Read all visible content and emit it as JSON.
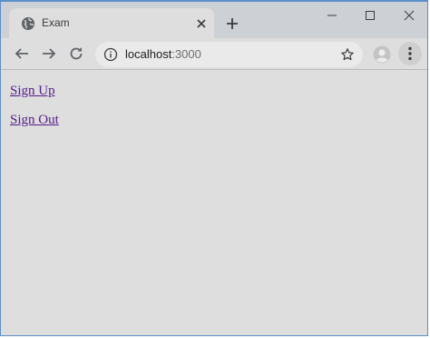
{
  "browser": {
    "tab": {
      "title": "Exam",
      "favicon": "globe-icon"
    },
    "address_bar": {
      "host": "localhost",
      "port": ":3000"
    },
    "icons": {
      "back": "arrow-left-icon",
      "forward": "arrow-right-icon",
      "reload": "reload-icon",
      "info": "info-icon",
      "bookmark": "star-icon",
      "profile": "profile-icon",
      "menu": "kebab-menu-icon",
      "new_tab": "plus-icon",
      "close_tab": "close-icon"
    },
    "colors": {
      "titlebar": "#cdd0d4",
      "toolbar": "#dedede",
      "window_border": "#5b8fc7"
    }
  },
  "page": {
    "links": [
      {
        "label": "Sign Up"
      },
      {
        "label": "Sign Out"
      }
    ],
    "colors": {
      "background": "#dedede",
      "visited_link": "#551a8b"
    }
  }
}
